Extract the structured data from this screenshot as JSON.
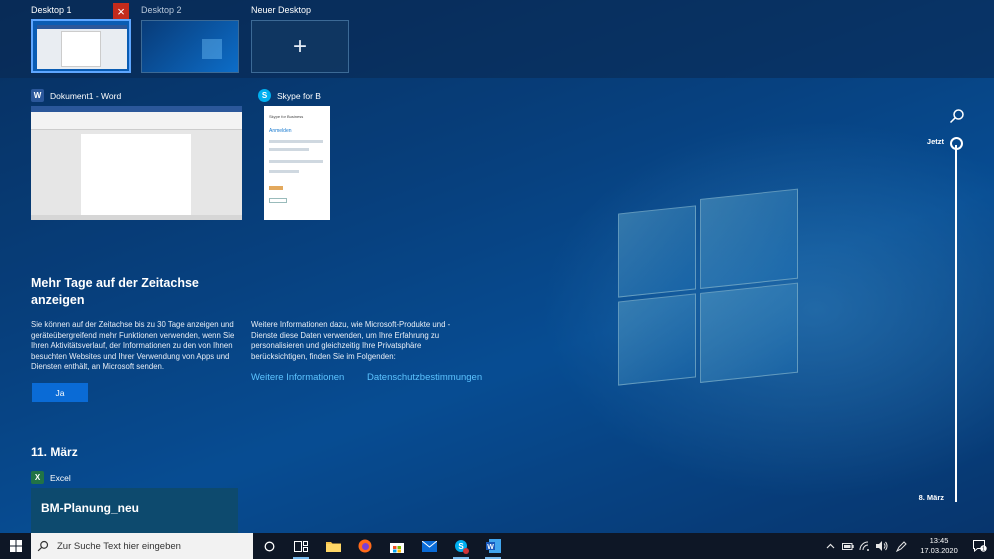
{
  "desktops": [
    {
      "label": "Desktop 1",
      "active": true
    },
    {
      "label": "Desktop 2",
      "active": false
    },
    {
      "label": "Neuer Desktop"
    }
  ],
  "windows": [
    {
      "title": "Dokument1 - Word",
      "icon": "word-icon",
      "icon_letter": "W",
      "color": "#2b579a"
    },
    {
      "title": "Skype for B",
      "icon": "skype-icon",
      "icon_letter": "S",
      "color": "#00aff0"
    }
  ],
  "skype_preview": {
    "header": "Skype for Business",
    "title": "Anmelden"
  },
  "info": {
    "heading": "Mehr Tage auf der Zeitachse anzeigen",
    "text_left": "Sie können auf der Zeitachse bis zu 30 Tage anzeigen und geräteübergreifend mehr Funktionen verwenden, wenn Sie Ihren Aktivitätsverlauf, der Informationen zu den von Ihnen besuchten Websites und Ihrer Verwendung von Apps und Diensten enthält, an Microsoft senden.",
    "text_right": "Weitere Informationen dazu, wie Microsoft-Produkte und -Dienste diese Daten verwenden, um Ihre Erfahrung zu personalisieren und gleichzeitig Ihre Privatsphäre berücksichtigen, finden Sie im Folgenden:",
    "link_more": "Weitere Informationen",
    "link_privacy": "Datenschutzbestimmungen",
    "button": "Ja"
  },
  "timeline_section": {
    "date": "11. März",
    "app": "Excel",
    "card_title": "BM-Planung_neu"
  },
  "timeline": {
    "top_label": "Jetzt",
    "bottom_label": "8. März"
  },
  "taskbar": {
    "search_placeholder": "Zur Suche Text hier eingeben",
    "time": "13:45",
    "date": "17.03.2020",
    "notification_count": "1"
  }
}
